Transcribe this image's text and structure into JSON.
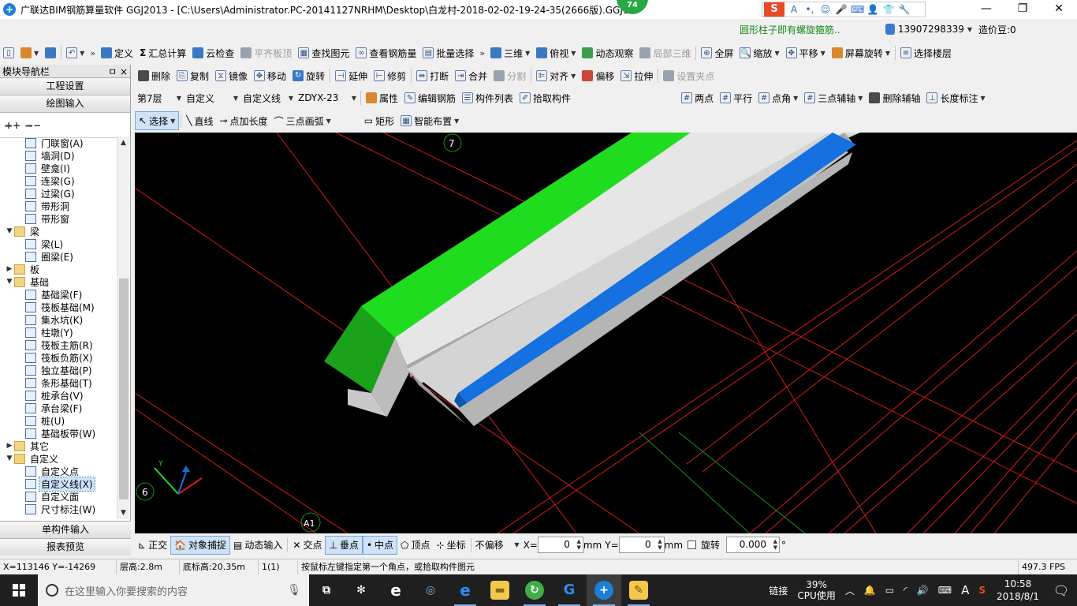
{
  "window": {
    "title": "广联达BIM钢筋算量软件 GGJ2013 - [C:\\Users\\Administrator.PC-20141127NRHM\\Desktop\\白龙村-2018-02-02-19-24-35(2666版).GGJ12]",
    "badge": "74",
    "min_glyph": "—",
    "max_glyph": "❐",
    "close_glyph": "✕"
  },
  "ime": {
    "logo": "S",
    "mode": "A"
  },
  "info": {
    "notice": "圆形柱子即有螺旋箍筋..",
    "phone": "13907298339",
    "beans": "造价豆:0"
  },
  "toolbar1": {
    "items": [
      "定义",
      "汇总计算",
      "云检查",
      "平齐板顶",
      "查找图元",
      "查看钢筋量",
      "批量选择"
    ],
    "right_items": [
      "三维",
      "俯视",
      "动态观察",
      "局部三维",
      "全屏",
      "缩放",
      "平移",
      "屏幕旋转",
      "选择楼层"
    ]
  },
  "toolbar2": {
    "items": [
      "删除",
      "复制",
      "镜像",
      "移动",
      "旋转",
      "延伸",
      "修剪",
      "打断",
      "合并",
      "分割",
      "对齐",
      "偏移",
      "拉伸",
      "设置夹点"
    ]
  },
  "toolbar3": {
    "floor": "第7层",
    "category": "自定义",
    "type": "自定义线",
    "component": "ZDYX-23",
    "items": [
      "属性",
      "编辑钢筋",
      "构件列表",
      "拾取构件"
    ],
    "axis_items": [
      "两点",
      "平行",
      "点角",
      "三点辅轴",
      "删除辅轴",
      "长度标注"
    ]
  },
  "toolbar4": {
    "items": [
      "选择",
      "直线",
      "点加长度",
      "三点画弧",
      "矩形",
      "智能布置"
    ]
  },
  "panel": {
    "title": "模块导航栏",
    "pin": "ㅁ",
    "close": "×",
    "btn_settings": "工程设置",
    "btn_drawing": "绘图输入",
    "tree": [
      {
        "label": "门联窗(A)",
        "level": 2,
        "folder": false
      },
      {
        "label": "墙洞(D)",
        "level": 2,
        "folder": false
      },
      {
        "label": "壁龛(I)",
        "level": 2,
        "folder": false
      },
      {
        "label": "连梁(G)",
        "level": 2,
        "folder": false
      },
      {
        "label": "过梁(G)",
        "level": 2,
        "folder": false
      },
      {
        "label": "带形洞",
        "level": 2,
        "folder": false
      },
      {
        "label": "带形窗",
        "level": 2,
        "folder": false
      },
      {
        "label": "梁",
        "level": 1,
        "folder": true,
        "open": true
      },
      {
        "label": "梁(L)",
        "level": 2,
        "folder": false
      },
      {
        "label": "圈梁(E)",
        "level": 2,
        "folder": false
      },
      {
        "label": "板",
        "level": 1,
        "folder": true,
        "open": false
      },
      {
        "label": "基础",
        "level": 1,
        "folder": true,
        "open": true
      },
      {
        "label": "基础梁(F)",
        "level": 2,
        "folder": false
      },
      {
        "label": "筏板基础(M)",
        "level": 2,
        "folder": false
      },
      {
        "label": "集水坑(K)",
        "level": 2,
        "folder": false
      },
      {
        "label": "柱墩(Y)",
        "level": 2,
        "folder": false
      },
      {
        "label": "筏板主筋(R)",
        "level": 2,
        "folder": false
      },
      {
        "label": "筏板负筋(X)",
        "level": 2,
        "folder": false
      },
      {
        "label": "独立基础(P)",
        "level": 2,
        "folder": false
      },
      {
        "label": "条形基础(T)",
        "level": 2,
        "folder": false
      },
      {
        "label": "桩承台(V)",
        "level": 2,
        "folder": false
      },
      {
        "label": "承台梁(F)",
        "level": 2,
        "folder": false
      },
      {
        "label": "桩(U)",
        "level": 2,
        "folder": false
      },
      {
        "label": "基础板带(W)",
        "level": 2,
        "folder": false
      },
      {
        "label": "其它",
        "level": 1,
        "folder": true,
        "open": false
      },
      {
        "label": "自定义",
        "level": 1,
        "folder": true,
        "open": true
      },
      {
        "label": "自定义点",
        "level": 2,
        "folder": false
      },
      {
        "label": "自定义线(X)",
        "level": 2,
        "folder": false,
        "selected": true
      },
      {
        "label": "自定义面",
        "level": 2,
        "folder": false
      },
      {
        "label": "尺寸标注(W)",
        "level": 2,
        "folder": false
      }
    ],
    "btn_single": "单构件输入",
    "btn_report": "报表预览"
  },
  "viewport": {
    "axis_labels": [
      "7",
      "6",
      "A1"
    ],
    "y_axis": "Y",
    "colors": {
      "green": "#1fdc1f",
      "blue": "#1570e0",
      "red_line": "#e01818"
    }
  },
  "snap": {
    "items": [
      "正交",
      "对象捕捉",
      "动态输入",
      "交点",
      "垂点",
      "中点",
      "顶点",
      "坐标"
    ],
    "offset": "不偏移",
    "x_label": "X=",
    "x_value": "0",
    "y_label": "Y=",
    "y_value": "0",
    "unit": "mm",
    "rotate_label": "旋转",
    "rotate_value": "0.000",
    "degree": "°"
  },
  "status": {
    "coords": "X=113146 Y=-14269",
    "floor_height": "层高:2.8m",
    "base_height": "底标高:20.35m",
    "count": "1(1)",
    "hint": "按鼠标左键指定第一个角点，或拾取构件图元",
    "fps": "497.3 FPS"
  },
  "taskbar": {
    "search_placeholder": "在这里输入你要搜索的内容",
    "link": "链接",
    "cpu_percent": "39%",
    "cpu_label": "CPU使用",
    "ime": "A",
    "time": "10:58",
    "date": "2018/8/1"
  }
}
